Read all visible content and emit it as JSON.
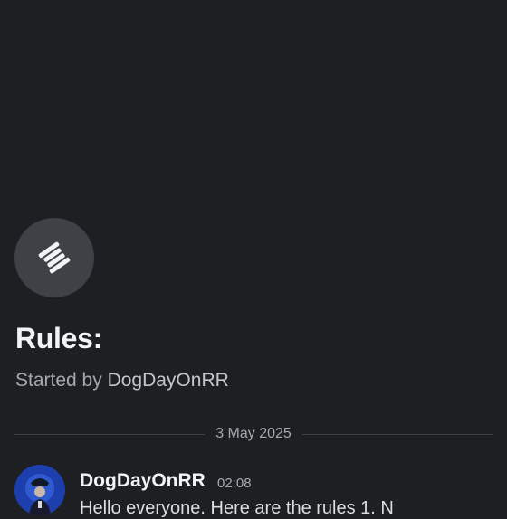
{
  "thread": {
    "icon": "thread-icon",
    "title": "Rules:",
    "started_prefix": "Started by ",
    "starter": "DogDayOnRR"
  },
  "divider": {
    "date": "3 May 2025"
  },
  "message": {
    "author": "DogDayOnRR",
    "timestamp": "02:08",
    "text": "Hello everyone. Here are the rules 1. N"
  },
  "colors": {
    "background": "#1e1f22",
    "icon_background": "#3f4147",
    "muted_text": "#a6a8ae"
  }
}
